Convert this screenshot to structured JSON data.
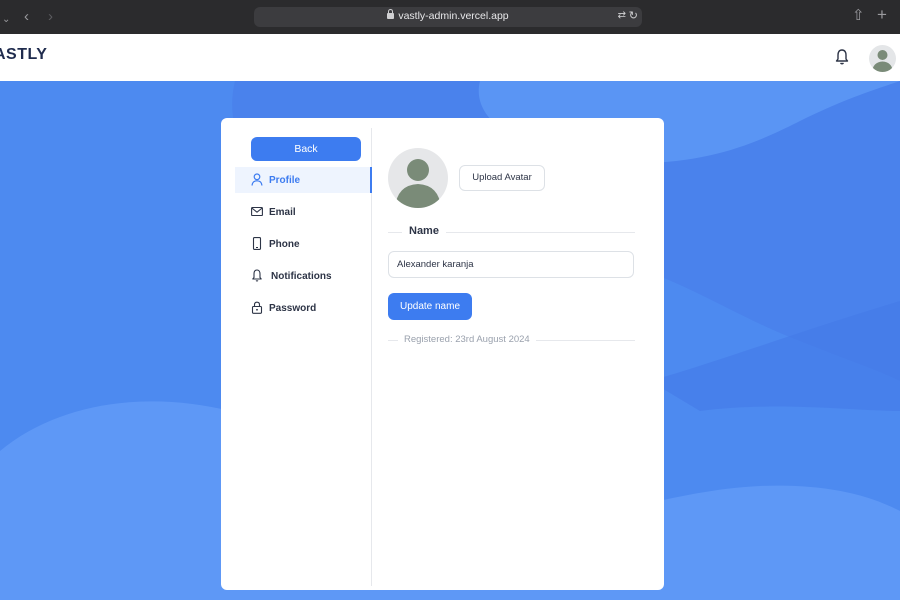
{
  "browser": {
    "url": "vastly-admin.vercel.app"
  },
  "header": {
    "logo": "ASTLY"
  },
  "sidebar": {
    "back_label": "Back",
    "items": [
      {
        "label": "Profile",
        "icon": "user-icon",
        "active": true
      },
      {
        "label": "Email",
        "icon": "mail-icon",
        "active": false
      },
      {
        "label": "Phone",
        "icon": "phone-icon",
        "active": false
      },
      {
        "label": "Notifications",
        "icon": "bell-icon",
        "active": false
      },
      {
        "label": "Password",
        "icon": "lock-icon",
        "active": false
      }
    ]
  },
  "profile": {
    "upload_label": "Upload Avatar",
    "name_section_label": "Name",
    "name_value": "Alexander karanja",
    "update_label": "Update name",
    "registered_text": "Registered: 23rd August 2024"
  },
  "colors": {
    "background": "#4d8af0",
    "accent": "#3d7cf0",
    "chrome": "#2b2b2d"
  }
}
